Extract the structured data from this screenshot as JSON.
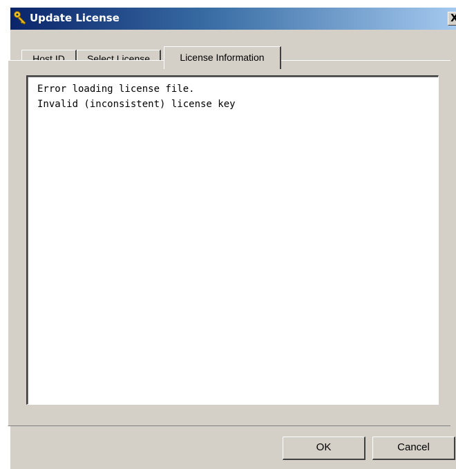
{
  "window": {
    "title": "Update License",
    "title_icon": "key-icon",
    "close_label": "X"
  },
  "tabs": [
    {
      "label": "Host ID",
      "active": false
    },
    {
      "label": "Select License",
      "active": false
    },
    {
      "label": "License Information",
      "active": true
    }
  ],
  "license_info": {
    "lines": [
      "Error loading license file.",
      "Invalid (inconsistent) license key"
    ]
  },
  "buttons": {
    "ok_label": "OK",
    "cancel_label": "Cancel"
  },
  "colors": {
    "titlebar_start": "#0a246a",
    "titlebar_end": "#a6caf0",
    "dialog_face": "#d4d0c8"
  }
}
